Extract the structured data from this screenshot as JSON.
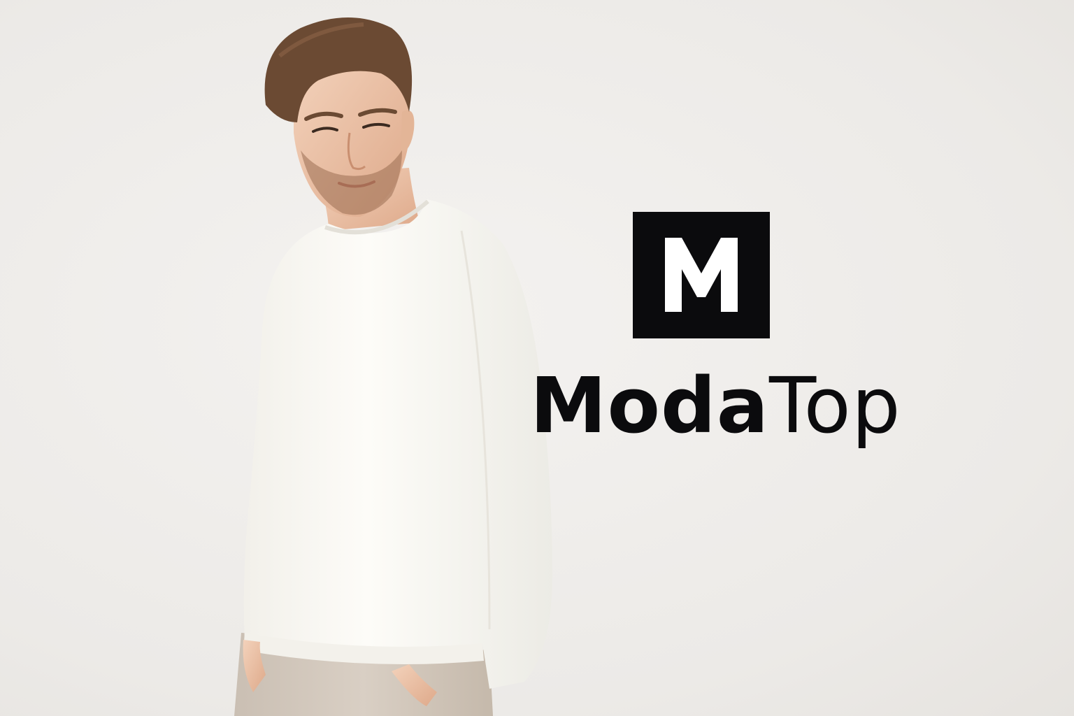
{
  "brand": {
    "monogram": "M",
    "name_bold": "Moda",
    "name_light": "Top"
  },
  "colors": {
    "background": "#efedeb",
    "logo": "#0b0b0d",
    "sweater": "#fbfaf6",
    "pants": "#d3c8bc",
    "hair": "#6b4a33"
  },
  "subject": {
    "person": "man-in-white-sweater"
  }
}
